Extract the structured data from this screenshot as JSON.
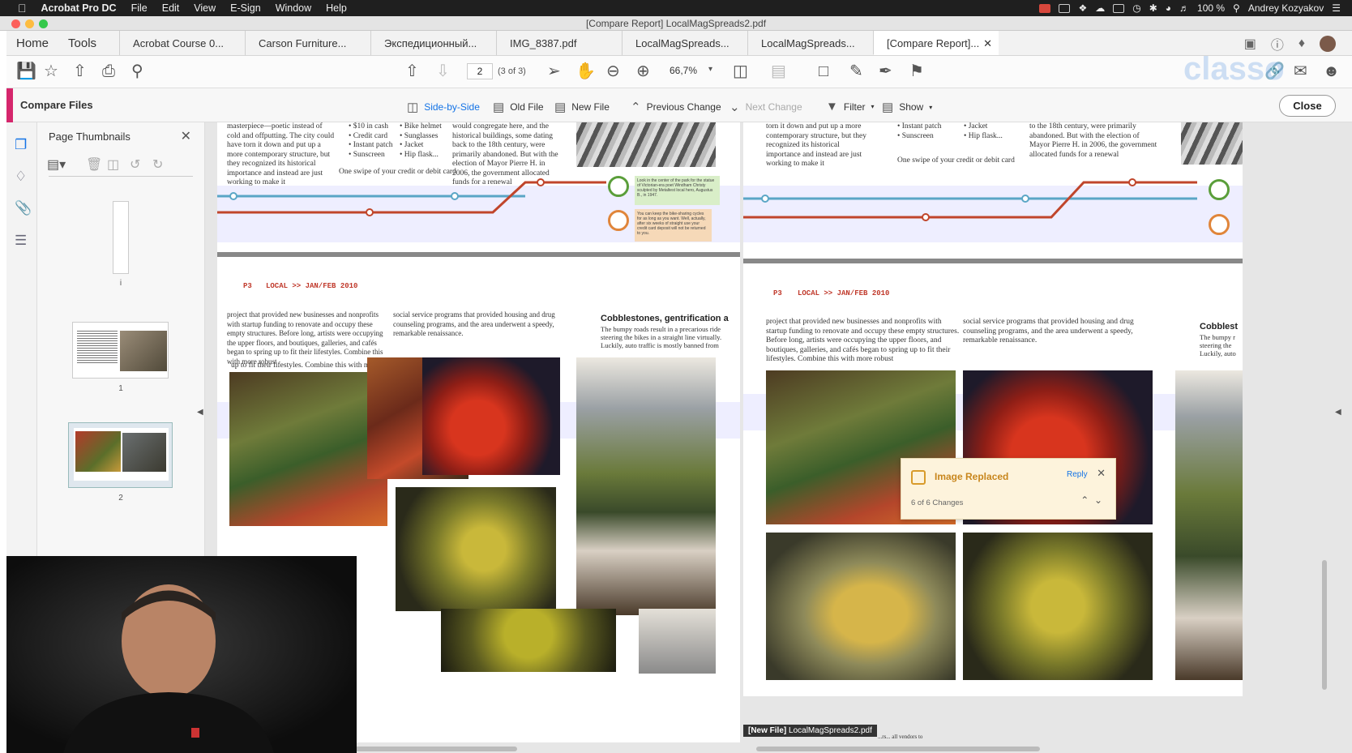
{
  "menubar": {
    "app_name": "Acrobat Pro DC",
    "items": [
      "File",
      "Edit",
      "View",
      "E-Sign",
      "Window",
      "Help"
    ],
    "battery": "100 %",
    "user": "Andrey Kozyakov"
  },
  "window": {
    "title": "[Compare Report] LocalMagSpreads2.pdf"
  },
  "tabs": {
    "home": "Home",
    "tools": "Tools",
    "docs": [
      "Acrobat Course 0...",
      "Carson Furniture...",
      "Экспедиционный...",
      "IMG_8387.pdf",
      "LocalMagSpreads...",
      "LocalMagSpreads...",
      "[Compare Report]..."
    ],
    "active_index": 6
  },
  "toolbar": {
    "page_current": "2",
    "page_of": "(3 of 3)",
    "zoom": "66,7%"
  },
  "compare": {
    "title": "Compare Files",
    "side_by_side": "Side-by-Side",
    "old_file": "Old File",
    "new_file": "New File",
    "prev_change": "Previous Change",
    "next_change": "Next Change",
    "filter": "Filter",
    "show": "Show",
    "close": "Close"
  },
  "thumbnails": {
    "title": "Page Thumbnails",
    "labels": [
      "i",
      "1",
      "2"
    ],
    "selected_index": 2
  },
  "popup": {
    "title": "Image Replaced",
    "reply": "Reply",
    "count": "6 of 6 Changes"
  },
  "article": {
    "section_label": "P3",
    "issue": "LOCAL >> JAN/FEB 2010",
    "heading": "Cobblestones, gentrification a",
    "heading_right": "Cobblest",
    "top_col1": "masterpiece—poetic instead of cold and offputting. The city could have torn it down and put up a more contemporary structure, but they recognized its historical importance and instead are just working to make it",
    "top_col1_right": "torn it down and put up a more contemporary structure, but they recognized its historical importance and instead are just working to make it",
    "checklist_a": [
      "$10 in cash",
      "Credit card",
      "Instant patch",
      "Sunscreen"
    ],
    "checklist_a_right": [
      "Instant patch",
      "Sunscreen"
    ],
    "checklist_b": [
      "Bike helmet",
      "Sunglasses",
      "Jacket",
      "Hip flask..."
    ],
    "checklist_b_right": [
      "Jacket",
      "Hip flask..."
    ],
    "swipe": "One swipe of your credit or debit card",
    "top_col3": "would congregate here, and the historical buildings, some dating back to the 18th century, were primarily abandoned. But with the election of Mayor Pierre H. in 2006, the government allocated funds for a renewal",
    "top_col3_right": "to the 18th century, were primarily abandoned. But with the election of Mayor Pierre H. in 2006, the government allocated funds for a renewal",
    "body1": "project that provided new businesses and nonprofits with startup funding to renovate and occupy these empty structures. Before long, artists were occupying the upper floors, and boutiques, galleries, and cafés began to spring up to fit their lifestyles. Combine this with more robust",
    "body1_tail": "up to fit their lifestyles. Combine this with more robust",
    "body2": "social service programs that provided housing and drug counseling programs, and the area underwent a speedy, remarkable renaissance.",
    "side_text": "The bumpy roads result in a precarious ride steering the bikes in a straight line virtually. Luckily, auto traffic is mostly banned from",
    "side_text_right": "The bumpy r steering the Luckily, auto",
    "note_green": "Look in the center of the park for the statue of Victorian-era poet Windham Christy sculpted by Metaltest local hero, Augustus B., in 1947.",
    "note_orange": "You can keep the bike-sharing cycles for as long as you want. Well, actually, after six weeks of straight use your credit card deposit will not be returned to you.",
    "new_file_label": "[New File]",
    "new_file_name": "LocalMagSpreads2.pdf",
    "bottom_note": "...rs... all vendors to"
  },
  "watermark": "classo",
  "colors": {
    "accent": "#1473e6",
    "compare_bar": "#d5266c",
    "timeline_blue": "#5aa6c6",
    "timeline_red": "#c0452b",
    "popup_title": "#c8861d"
  },
  "icons": [
    "apple-icon",
    "save-icon",
    "star-icon",
    "upload-icon",
    "print-icon",
    "search-icon",
    "prev-page-icon",
    "next-page-icon",
    "select-icon",
    "hand-icon",
    "zoom-out-icon",
    "zoom-in-icon",
    "comment-icon",
    "pen-icon",
    "sign-icon",
    "stamp-icon",
    "filter-icon",
    "thumbnails-icon",
    "bookmark-icon",
    "attachment-icon",
    "layers-icon"
  ]
}
